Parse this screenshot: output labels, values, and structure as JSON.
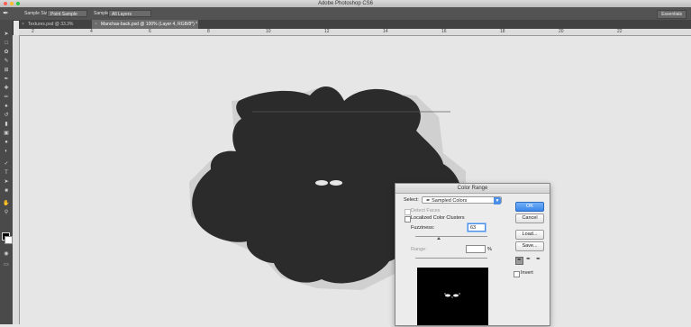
{
  "app": {
    "title": "Adobe Photoshop CS6"
  },
  "options_bar": {
    "sample_size_label": "Sample Size:",
    "sample_size_value": "Point Sample",
    "sample_label": "Sample:",
    "sample_value": "All Layers",
    "workspace": "Essentials"
  },
  "tabs": [
    {
      "label": "Textures.psd @ 33.3% (RGB/8) *"
    },
    {
      "label": "Manchas-back.psd @ 100% (Layer 4, RGB/8*) *"
    }
  ],
  "ruler": {
    "ticks": [
      "2",
      "4",
      "6",
      "8",
      "10",
      "12",
      "14",
      "16",
      "18",
      "20",
      "22"
    ]
  },
  "dialog": {
    "title": "Color Range",
    "select_label": "Select:",
    "select_value": "Sampled Colors",
    "detect_faces": "Detect Faces",
    "localized": "Localized Color Clusters",
    "fuzziness_label": "Fuzziness:",
    "fuzziness_value": "63",
    "range_label": "Range:",
    "range_unit": "%",
    "invert_label": "Invert",
    "ok": "OK",
    "cancel": "Cancel",
    "load": "Load...",
    "save": "Save..."
  },
  "colors": {
    "ui_dark": "#535353",
    "toolbar": "#4a4a4a",
    "canvas": "#e6e6e6",
    "blot": "#2b2b2b",
    "accent": "#3a86e8"
  }
}
